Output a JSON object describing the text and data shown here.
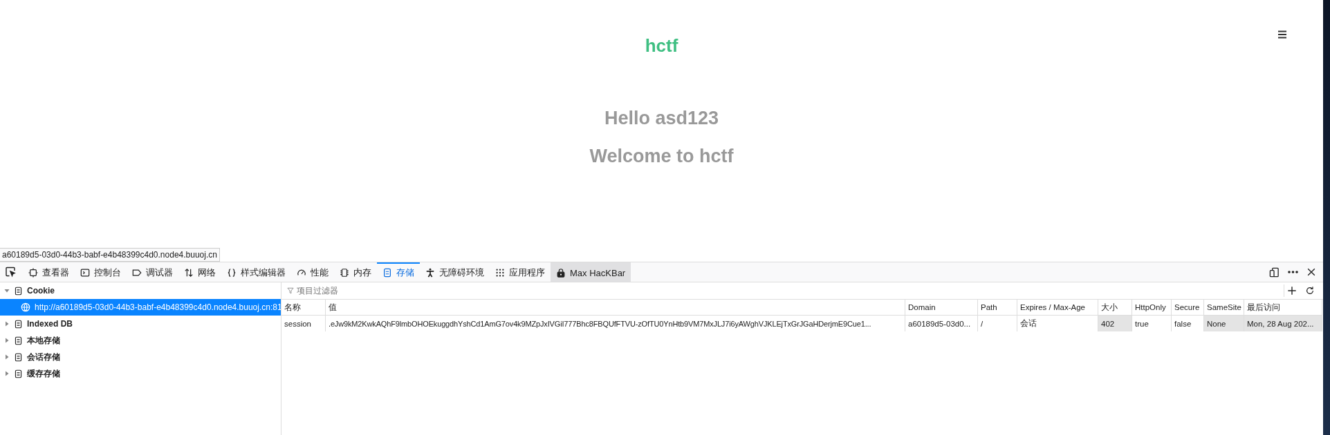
{
  "page": {
    "logo": "hctf",
    "greeting": "Hello asd123",
    "welcome": "Welcome to hctf"
  },
  "status_url": "a60189d5-03d0-44b3-babf-e4b48399c4d0.node4.buuoj.cn",
  "devtools": {
    "tabs": [
      {
        "label": "查看器",
        "selected": false,
        "highlighted": false
      },
      {
        "label": "控制台",
        "selected": false,
        "highlighted": false
      },
      {
        "label": "调试器",
        "selected": false,
        "highlighted": false
      },
      {
        "label": "网络",
        "selected": false,
        "highlighted": false
      },
      {
        "label": "样式编辑器",
        "selected": false,
        "highlighted": false
      },
      {
        "label": "性能",
        "selected": false,
        "highlighted": false
      },
      {
        "label": "内存",
        "selected": false,
        "highlighted": false
      },
      {
        "label": "存储",
        "selected": true,
        "highlighted": false
      },
      {
        "label": "无障碍环境",
        "selected": false,
        "highlighted": false
      },
      {
        "label": "应用程序",
        "selected": false,
        "highlighted": false
      },
      {
        "label": "Max HacKBar",
        "selected": false,
        "highlighted": true
      }
    ],
    "tree": [
      {
        "label": "Cookie",
        "expanded": true,
        "selected": false,
        "children": [
          {
            "label": "http://a60189d5-03d0-44b3-babf-e4b48399c4d0.node4.buuoj.cn:81",
            "selected": true
          }
        ]
      },
      {
        "label": "Indexed DB",
        "expanded": false,
        "selected": false
      },
      {
        "label": "本地存储",
        "expanded": false,
        "selected": false
      },
      {
        "label": "会话存储",
        "expanded": false,
        "selected": false
      },
      {
        "label": "缓存存储",
        "expanded": false,
        "selected": false
      }
    ],
    "filter": {
      "placeholder": "项目过滤器"
    },
    "table": {
      "columns": [
        {
          "label": "名称",
          "shaded": false
        },
        {
          "label": "值",
          "shaded": false
        },
        {
          "label": "Domain",
          "shaded": false
        },
        {
          "label": "Path",
          "shaded": false
        },
        {
          "label": "Expires / Max-Age",
          "shaded": false
        },
        {
          "label": "大小",
          "shaded": true
        },
        {
          "label": "HttpOnly",
          "shaded": false
        },
        {
          "label": "Secure",
          "shaded": false
        },
        {
          "label": "SameSite",
          "shaded": true
        },
        {
          "label": "最后访问",
          "shaded": true
        }
      ],
      "rows": [
        {
          "cells": [
            "session",
            ".eJw9kM2KwkAQhF9lmbOHOEkuggdhYshCd1AmG7ov4k9MZpJxIVGiI777Bhc8FBQUfFTVU-zOfTU0YnHtb9VM7MxJLJ7i6yAWghVJKLEjTxGrJGaHDerjmE9Cue1...",
            "a60189d5-03d0...",
            "/",
            "会话",
            "402",
            "true",
            "false",
            "None",
            "Mon, 28 Aug 202..."
          ]
        }
      ]
    }
  }
}
